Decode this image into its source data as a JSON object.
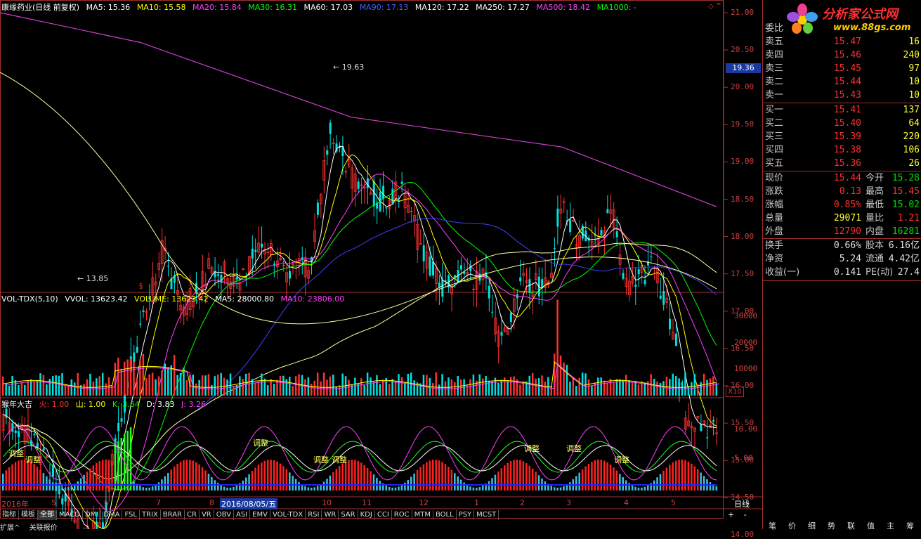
{
  "main_header": {
    "title": "康缘药业(日线 前复权)",
    "ma5": "MA5: 15.36",
    "ma10": "MA10: 15.58",
    "ma20": "MA20: 15.84",
    "ma30": "MA30: 16.31",
    "ma60": "MA60: 17.03",
    "ma90": "MA90: 17.13",
    "ma120": "MA120: 17.22",
    "ma250": "MA250: 17.27",
    "ma500": "MA500: 18.42",
    "ma1000": "MA1000: -"
  },
  "price_axis": [
    "21.00",
    "20.50",
    "20.00",
    "19.50",
    "19.00",
    "18.50",
    "18.00",
    "17.50",
    "17.00",
    "16.50",
    "16.00",
    "15.50",
    "15.00",
    "14.50",
    "14.00"
  ],
  "current_price_tag": "19.36",
  "annotations": {
    "high": "19.63",
    "low": "13.85"
  },
  "vol_header": {
    "name": "VOL-TDX(5,10)",
    "vvol": "VVOL: 13623.42",
    "volume": "VOLUME: 13623.42",
    "ma5": "MA5: 28000.80",
    "ma10": "MA10: 23806.00"
  },
  "vol_axis": [
    "30000",
    "20000",
    "10000"
  ],
  "vol_unit": "X10",
  "ind_header": {
    "name": "猴年大吉",
    "fire": "火: 1.00",
    "mountain": "山: 1.00",
    "k": "K: 3.64",
    "d": "D: 3.83",
    "j": "J: 3.26"
  },
  "ind_axis": [
    "10.00",
    "5.00"
  ],
  "ind_labels": [
    "调整",
    "调整",
    "调整",
    "调整",
    "调整",
    "调整",
    "调整",
    "调整",
    "调整"
  ],
  "date_axis": {
    "year": "2016年",
    "months": [
      "5",
      "6",
      "7",
      "8",
      "10",
      "11",
      "12",
      "1",
      "2",
      "3",
      "4",
      "5"
    ],
    "cursor_date": "2016/08/05/五",
    "period": "日线"
  },
  "tabs": [
    "指标",
    "模板",
    "全部",
    "MACD",
    "DMI",
    "DMA",
    "FSL",
    "TRIX",
    "BRAR",
    "CR",
    "VR",
    "OBV",
    "ASI",
    "EMV",
    "VOL-TDX",
    "RSI",
    "WR",
    "SAR",
    "KDJ",
    "CCI",
    "ROC",
    "MTM",
    "BOLL",
    "PSY",
    "MCST"
  ],
  "bottom_left": [
    "扩展^",
    "关联报价"
  ],
  "zoom_controls": [
    "+",
    "-"
  ],
  "logo": {
    "title": "分析家公式网",
    "url": "www.88gs.com"
  },
  "order_book": {
    "header_label": "委比",
    "asks": [
      {
        "label": "卖五",
        "price": "15.47",
        "vol": "16"
      },
      {
        "label": "卖四",
        "price": "15.46",
        "vol": "240"
      },
      {
        "label": "卖三",
        "price": "15.45",
        "vol": "97"
      },
      {
        "label": "卖二",
        "price": "15.44",
        "vol": "10"
      },
      {
        "label": "卖一",
        "price": "15.43",
        "vol": "10"
      }
    ],
    "bids": [
      {
        "label": "买一",
        "price": "15.41",
        "vol": "137"
      },
      {
        "label": "买二",
        "price": "15.40",
        "vol": "64"
      },
      {
        "label": "买三",
        "price": "15.39",
        "vol": "220"
      },
      {
        "label": "买四",
        "price": "15.38",
        "vol": "106"
      },
      {
        "label": "买五",
        "price": "15.36",
        "vol": "26"
      }
    ]
  },
  "quote": [
    {
      "l1": "现价",
      "v1": "15.44",
      "c1": "red",
      "l2": "今开",
      "v2": "15.28",
      "c2": "green"
    },
    {
      "l1": "涨跌",
      "v1": "0.13",
      "c1": "red",
      "l2": "最高",
      "v2": "15.45",
      "c2": "red"
    },
    {
      "l1": "涨幅",
      "v1": "0.85%",
      "c1": "red",
      "l2": "最低",
      "v2": "15.02",
      "c2": "green"
    },
    {
      "l1": "总量",
      "v1": "29071",
      "c1": "yellow",
      "l2": "量比",
      "v2": "1.21",
      "c2": "red"
    },
    {
      "l1": "外盘",
      "v1": "12790",
      "c1": "red",
      "l2": "内盘",
      "v2": "16281",
      "c2": "green"
    }
  ],
  "fundamentals": [
    {
      "l1": "换手",
      "v1": "0.66%",
      "l2": "股本",
      "v2": "6.16亿"
    },
    {
      "l1": "净资",
      "v1": "5.24",
      "l2": "流通",
      "v2": "4.42亿"
    },
    {
      "l1": "收益(一)",
      "v1": "0.141",
      "l2": "PE(动)",
      "v2": "27.4"
    }
  ],
  "panel_bottom_tabs": [
    "笔",
    "价",
    "细",
    "势",
    "联",
    "值",
    "主",
    "筹"
  ],
  "colors": {
    "up": "#ff3030",
    "down": "#00ffff",
    "border": "#a03030",
    "ma5": "#ffffff",
    "ma10": "#ffff00",
    "ma20": "#ff00ff",
    "ma30": "#00ff00",
    "ma60": "#5050ff",
    "ma120": "#ffff80",
    "ma250": "#c040c0"
  }
}
